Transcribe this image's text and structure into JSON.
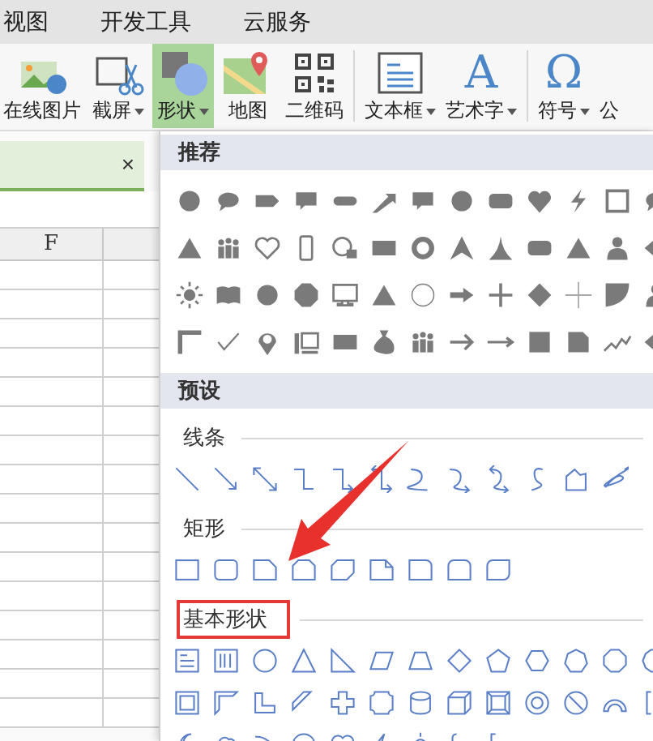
{
  "menu": [
    {
      "label": "视图"
    },
    {
      "label": "开发工具"
    },
    {
      "label": "云服务"
    }
  ],
  "ribbon": {
    "groups": [
      [
        {
          "label": "在线图片",
          "dropdown": false,
          "selected": false
        },
        {
          "label": "截屏",
          "dropdown": true,
          "selected": false
        },
        {
          "label": "形状",
          "dropdown": true,
          "selected": true
        },
        {
          "label": "地图",
          "dropdown": false,
          "selected": false
        },
        {
          "label": "二维码",
          "dropdown": false,
          "selected": false
        }
      ],
      [
        {
          "label": "文本框",
          "dropdown": true,
          "selected": false
        },
        {
          "label": "艺术字",
          "glyph": "A",
          "dropdown": true,
          "selected": false
        }
      ],
      [
        {
          "label": "符号",
          "glyph": "Ω",
          "dropdown": true,
          "selected": false
        },
        {
          "label": "公",
          "dropdown": false,
          "selected": false
        }
      ]
    ]
  },
  "document_tab": {
    "close": "×"
  },
  "sheet": {
    "column_headers": [
      "F"
    ]
  },
  "shape_panel": {
    "sections": [
      {
        "title": "推荐",
        "kind": "gallery"
      },
      {
        "title": "预设",
        "kind": "groups",
        "groups": [
          {
            "label": "线条",
            "highlighted": false
          },
          {
            "label": "矩形",
            "highlighted": false
          },
          {
            "label": "基本形状",
            "highlighted": true
          }
        ]
      }
    ]
  }
}
